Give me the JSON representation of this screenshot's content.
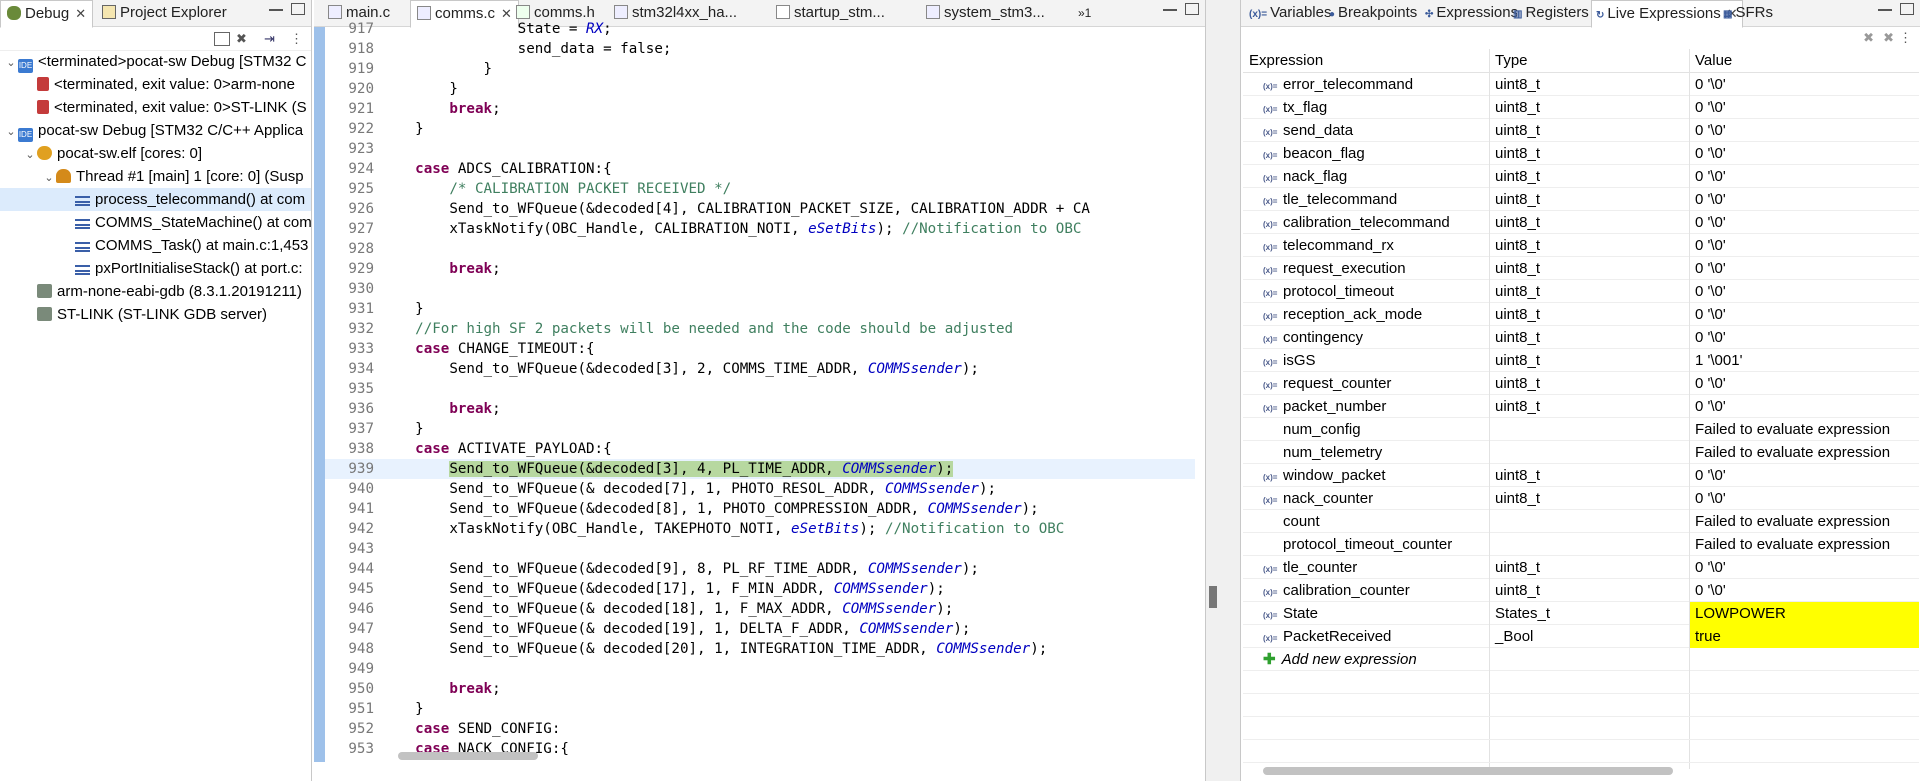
{
  "left_tabs": [
    {
      "label": "Debug"
    },
    {
      "label": "Project Explorer"
    }
  ],
  "tree": [
    {
      "text": "<terminated>pocat-sw Debug [STM32 C",
      "icon": "ide",
      "indent": 0,
      "twisty": "v"
    },
    {
      "text": "<terminated, exit value: 0>arm-none",
      "icon": "term",
      "indent": 1,
      "twisty": ""
    },
    {
      "text": "<terminated, exit value: 0>ST-LINK (S",
      "icon": "term",
      "indent": 1,
      "twisty": ""
    },
    {
      "text": "pocat-sw Debug [STM32 C/C++ Applica",
      "icon": "ide",
      "indent": 0,
      "twisty": "v"
    },
    {
      "text": "pocat-sw.elf [cores: 0]",
      "icon": "elf",
      "indent": 1,
      "twisty": "v"
    },
    {
      "text": "Thread #1 [main] 1 [core: 0] (Susp",
      "icon": "thread",
      "indent": 2,
      "twisty": "v"
    },
    {
      "text": "process_telecommand() at com",
      "icon": "frame",
      "indent": 3,
      "twisty": "",
      "selected": true
    },
    {
      "text": "COMMS_StateMachine() at com",
      "icon": "frame",
      "indent": 3,
      "twisty": ""
    },
    {
      "text": "COMMS_Task() at main.c:1,453",
      "icon": "frame",
      "indent": 3,
      "twisty": ""
    },
    {
      "text": "pxPortInitialiseStack() at port.c:",
      "icon": "frame",
      "indent": 3,
      "twisty": ""
    },
    {
      "text": "arm-none-eabi-gdb (8.3.1.20191211)",
      "icon": "gdb",
      "indent": 1,
      "twisty": ""
    },
    {
      "text": "ST-LINK (ST-LINK GDB server)",
      "icon": "gdb",
      "indent": 1,
      "twisty": ""
    }
  ],
  "editor_tabs": [
    {
      "label": "main.c"
    },
    {
      "label": "comms.c"
    },
    {
      "label": "comms.h"
    },
    {
      "label": "stm32l4xx_ha..."
    },
    {
      "label": "startup_stm..."
    },
    {
      "label": "system_stm3..."
    },
    {
      "label": "»1"
    }
  ],
  "code_lines": [
    {
      "n": "917",
      "segs": [
        [
          "t",
          "                State = "
        ],
        [
          "i",
          "RX"
        ],
        [
          "t",
          ";"
        ]
      ]
    },
    {
      "n": "918",
      "segs": [
        [
          "t",
          "                send_data = false;"
        ]
      ]
    },
    {
      "n": "919",
      "segs": [
        [
          "t",
          "            }"
        ]
      ]
    },
    {
      "n": "920",
      "segs": [
        [
          "t",
          "        }"
        ]
      ]
    },
    {
      "n": "921",
      "segs": [
        [
          "t",
          "        "
        ],
        [
          "k",
          "break"
        ],
        [
          "t",
          ";"
        ]
      ]
    },
    {
      "n": "922",
      "segs": [
        [
          "t",
          "    }"
        ]
      ]
    },
    {
      "n": "923",
      "segs": [
        [
          "t",
          ""
        ]
      ]
    },
    {
      "n": "924",
      "segs": [
        [
          "t",
          "    "
        ],
        [
          "k",
          "case"
        ],
        [
          "t",
          " ADCS_CALIBRATION:{"
        ]
      ]
    },
    {
      "n": "925",
      "segs": [
        [
          "t",
          "        "
        ],
        [
          "c",
          "/* CALIBRATION PACKET RECEIVED */"
        ]
      ]
    },
    {
      "n": "926",
      "segs": [
        [
          "t",
          "        Send_to_WFQueue(&decoded[4], CALIBRATION_PACKET_SIZE, CALIBRATION_ADDR + CA"
        ]
      ]
    },
    {
      "n": "927",
      "segs": [
        [
          "t",
          "        xTaskNotify(OBC_Handle, CALIBRATION_NOTI, "
        ],
        [
          "i",
          "eSetBits"
        ],
        [
          "t",
          "); "
        ],
        [
          "c",
          "//Notification to OBC"
        ]
      ]
    },
    {
      "n": "928",
      "segs": [
        [
          "t",
          ""
        ]
      ]
    },
    {
      "n": "929",
      "segs": [
        [
          "t",
          "        "
        ],
        [
          "k",
          "break"
        ],
        [
          "t",
          ";"
        ]
      ]
    },
    {
      "n": "930",
      "segs": [
        [
          "t",
          ""
        ]
      ]
    },
    {
      "n": "931",
      "segs": [
        [
          "t",
          "    }"
        ]
      ]
    },
    {
      "n": "932",
      "segs": [
        [
          "t",
          "    "
        ],
        [
          "c",
          "//For high SF 2 packets will be needed and the code should be adjusted"
        ]
      ]
    },
    {
      "n": "933",
      "segs": [
        [
          "t",
          "    "
        ],
        [
          "k",
          "case"
        ],
        [
          "t",
          " CHANGE_TIMEOUT:{"
        ]
      ]
    },
    {
      "n": "934",
      "segs": [
        [
          "t",
          "        Send_to_WFQueue(&decoded[3], 2, COMMS_TIME_ADDR, "
        ],
        [
          "i",
          "COMMSsender"
        ],
        [
          "t",
          ");"
        ]
      ]
    },
    {
      "n": "935",
      "segs": [
        [
          "t",
          ""
        ]
      ]
    },
    {
      "n": "936",
      "segs": [
        [
          "t",
          "        "
        ],
        [
          "k",
          "break"
        ],
        [
          "t",
          ";"
        ]
      ]
    },
    {
      "n": "937",
      "segs": [
        [
          "t",
          "    }"
        ]
      ]
    },
    {
      "n": "938",
      "segs": [
        [
          "t",
          "    "
        ],
        [
          "k",
          "case"
        ],
        [
          "t",
          " ACTIVATE_PAYLOAD:{"
        ]
      ]
    },
    {
      "n": "939",
      "segs": [
        [
          "t",
          "        "
        ],
        [
          "h",
          "Send_to_WFQueue(&decoded[3], 4, PL_TIME_ADDR, "
        ],
        [
          "hi",
          "COMMSsender"
        ],
        [
          "h",
          ");"
        ]
      ],
      "highlight": true
    },
    {
      "n": "940",
      "segs": [
        [
          "t",
          "        Send_to_WFQueue(& decoded[7], 1, PHOTO_RESOL_ADDR, "
        ],
        [
          "i",
          "COMMSsender"
        ],
        [
          "t",
          ");"
        ]
      ]
    },
    {
      "n": "941",
      "segs": [
        [
          "t",
          "        Send_to_WFQueue(&decoded[8], 1, PHOTO_COMPRESSION_ADDR, "
        ],
        [
          "i",
          "COMMSsender"
        ],
        [
          "t",
          ");"
        ]
      ]
    },
    {
      "n": "942",
      "segs": [
        [
          "t",
          "        xTaskNotify(OBC_Handle, TAKEPHOTO_NOTI, "
        ],
        [
          "i",
          "eSetBits"
        ],
        [
          "t",
          "); "
        ],
        [
          "c",
          "//Notification to OBC"
        ]
      ]
    },
    {
      "n": "943",
      "segs": [
        [
          "t",
          ""
        ]
      ]
    },
    {
      "n": "944",
      "segs": [
        [
          "t",
          "        Send_to_WFQueue(&decoded[9], 8, PL_RF_TIME_ADDR, "
        ],
        [
          "i",
          "COMMSsender"
        ],
        [
          "t",
          ");"
        ]
      ]
    },
    {
      "n": "945",
      "segs": [
        [
          "t",
          "        Send_to_WFQueue(&decoded[17], 1, F_MIN_ADDR, "
        ],
        [
          "i",
          "COMMSsender"
        ],
        [
          "t",
          ");"
        ]
      ]
    },
    {
      "n": "946",
      "segs": [
        [
          "t",
          "        Send_to_WFQueue(& decoded[18], 1, F_MAX_ADDR, "
        ],
        [
          "i",
          "COMMSsender"
        ],
        [
          "t",
          ");"
        ]
      ]
    },
    {
      "n": "947",
      "segs": [
        [
          "t",
          "        Send_to_WFQueue(& decoded[19], 1, DELTA_F_ADDR, "
        ],
        [
          "i",
          "COMMSsender"
        ],
        [
          "t",
          ");"
        ]
      ]
    },
    {
      "n": "948",
      "segs": [
        [
          "t",
          "        Send_to_WFQueue(& decoded[20], 1, INTEGRATION_TIME_ADDR, "
        ],
        [
          "i",
          "COMMSsender"
        ],
        [
          "t",
          ");"
        ]
      ]
    },
    {
      "n": "949",
      "segs": [
        [
          "t",
          ""
        ]
      ]
    },
    {
      "n": "950",
      "segs": [
        [
          "t",
          "        "
        ],
        [
          "k",
          "break"
        ],
        [
          "t",
          ";"
        ]
      ]
    },
    {
      "n": "951",
      "segs": [
        [
          "t",
          "    }"
        ]
      ]
    },
    {
      "n": "952",
      "segs": [
        [
          "t",
          "    "
        ],
        [
          "k",
          "case"
        ],
        [
          "t",
          " SEND_CONFIG:"
        ]
      ]
    },
    {
      "n": "953",
      "segs": [
        [
          "t",
          "    "
        ],
        [
          "k",
          "case"
        ],
        [
          "t",
          " NACK_CONFIG:{"
        ]
      ]
    }
  ],
  "right_tabs": [
    {
      "label": "Variables",
      "prefix": "(x)="
    },
    {
      "label": "Breakpoints",
      "prefix": "●"
    },
    {
      "label": "Expressions",
      "prefix": "✣"
    },
    {
      "label": "Registers",
      "prefix": "▥"
    },
    {
      "label": "Live Expressions",
      "prefix": "↻"
    },
    {
      "label": "SFRs",
      "prefix": "▦"
    }
  ],
  "columns": {
    "expression": "Expression",
    "type": "Type",
    "value": "Value"
  },
  "expressions": [
    {
      "name": "error_telecommand",
      "type": "uint8_t",
      "value": "0 '\\0'",
      "xy": true
    },
    {
      "name": "tx_flag",
      "type": "uint8_t",
      "value": "0 '\\0'",
      "xy": true
    },
    {
      "name": "send_data",
      "type": "uint8_t",
      "value": "0 '\\0'",
      "xy": true
    },
    {
      "name": "beacon_flag",
      "type": "uint8_t",
      "value": "0 '\\0'",
      "xy": true
    },
    {
      "name": "nack_flag",
      "type": "uint8_t",
      "value": "0 '\\0'",
      "xy": true
    },
    {
      "name": "tle_telecommand",
      "type": "uint8_t",
      "value": "0 '\\0'",
      "xy": true
    },
    {
      "name": "calibration_telecommand",
      "type": "uint8_t",
      "value": "0 '\\0'",
      "xy": true
    },
    {
      "name": "telecommand_rx",
      "type": "uint8_t",
      "value": "0 '\\0'",
      "xy": true
    },
    {
      "name": "request_execution",
      "type": "uint8_t",
      "value": "0 '\\0'",
      "xy": true
    },
    {
      "name": "protocol_timeout",
      "type": "uint8_t",
      "value": "0 '\\0'",
      "xy": true
    },
    {
      "name": "reception_ack_mode",
      "type": "uint8_t",
      "value": "0 '\\0'",
      "xy": true
    },
    {
      "name": "contingency",
      "type": "uint8_t",
      "value": "0 '\\0'",
      "xy": true
    },
    {
      "name": "isGS",
      "type": "uint8_t",
      "value": "1 '\\001'",
      "xy": true
    },
    {
      "name": "request_counter",
      "type": "uint8_t",
      "value": "0 '\\0'",
      "xy": true
    },
    {
      "name": "packet_number",
      "type": "uint8_t",
      "value": "0 '\\0'",
      "xy": true
    },
    {
      "name": "num_config",
      "type": "",
      "value": "Failed to evaluate expression",
      "xy": false
    },
    {
      "name": "num_telemetry",
      "type": "",
      "value": "Failed to evaluate expression",
      "xy": false
    },
    {
      "name": "window_packet",
      "type": "uint8_t",
      "value": "0 '\\0'",
      "xy": true
    },
    {
      "name": "nack_counter",
      "type": "uint8_t",
      "value": "0 '\\0'",
      "xy": true
    },
    {
      "name": "count",
      "type": "",
      "value": "Failed to evaluate expression",
      "xy": false
    },
    {
      "name": "protocol_timeout_counter",
      "type": "",
      "value": "Failed to evaluate expression",
      "xy": false
    },
    {
      "name": "tle_counter",
      "type": "uint8_t",
      "value": "0 '\\0'",
      "xy": true
    },
    {
      "name": "calibration_counter",
      "type": "uint8_t",
      "value": "0 '\\0'",
      "xy": true
    },
    {
      "name": "State",
      "type": "States_t",
      "value": "LOWPOWER",
      "xy": true,
      "highlight": true
    },
    {
      "name": "PacketReceived",
      "type": "_Bool",
      "value": "true",
      "xy": true,
      "highlight": true
    }
  ],
  "add_expression_label": "Add new expression",
  "colors": {
    "highlight_value": "#ffff00",
    "current_line": "#b7d8a0",
    "keyword": "#7f0055",
    "comment": "#3f7f5f",
    "italic_ident": "#0000c0"
  }
}
